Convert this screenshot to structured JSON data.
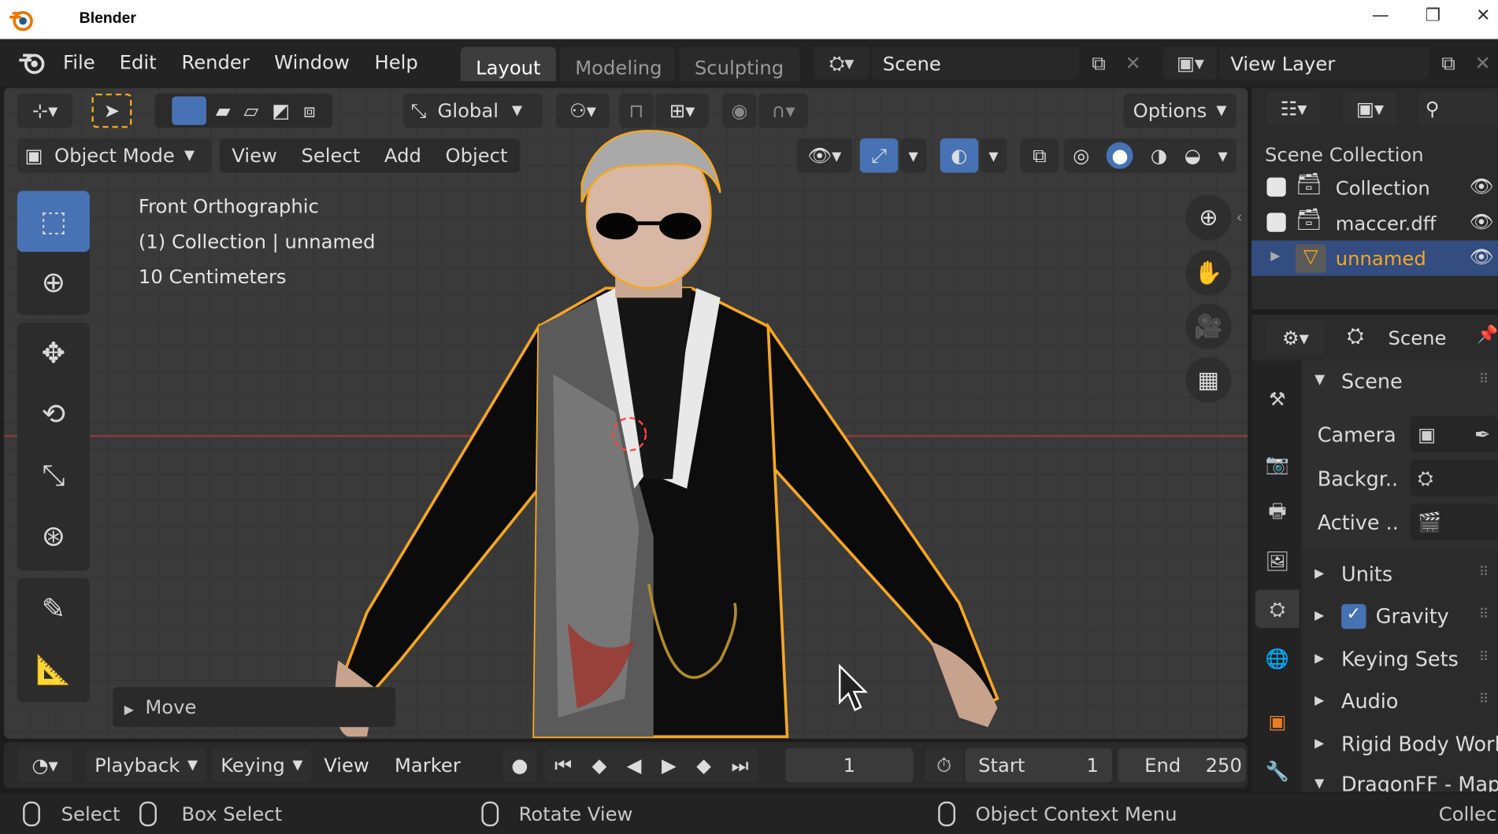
{
  "window": {
    "title": "Blender",
    "min": "—",
    "restore": "❐",
    "close": "✕"
  },
  "menu": {
    "file": "File",
    "edit": "Edit",
    "render": "Render",
    "window": "Window",
    "help": "Help"
  },
  "workspaces": [
    "Layout",
    "Modeling",
    "Sculpting"
  ],
  "scene_field": "Scene",
  "view_layer_field": "View Layer",
  "tool_header": {
    "transform_orientation": "Global",
    "options": "Options"
  },
  "viewport_header": {
    "mode": "Object Mode",
    "view": "View",
    "select": "Select",
    "add": "Add",
    "object": "Object"
  },
  "viewport_info": {
    "line1": "Front Orthographic",
    "line2": "(1) Collection | unnamed",
    "line3": "10 Centimeters"
  },
  "operator_panel": {
    "label": "Move"
  },
  "outliner": {
    "root": "Scene Collection",
    "items": [
      {
        "label": "Collection",
        "checked": true,
        "selected": false
      },
      {
        "label": "maccer.dff",
        "checked": true,
        "selected": false
      },
      {
        "label": "unnamed",
        "checked": null,
        "selected": true
      }
    ]
  },
  "properties": {
    "header": "Scene",
    "section": "Scene",
    "fields": [
      {
        "label": "Camera"
      },
      {
        "label": "Backgr.."
      },
      {
        "label": "Active .."
      }
    ],
    "subpanels": [
      "Units",
      "Gravity",
      "Keying Sets",
      "Audio",
      "Rigid Body World",
      "DragonFF - Map"
    ]
  },
  "timeline": {
    "playback": "Playback",
    "keying": "Keying",
    "view": "View",
    "marker": "Marker",
    "current_frame": "1",
    "start_label": "Start",
    "start_value": "1",
    "end_label": "End",
    "end_value": "250"
  },
  "status": {
    "select": "Select",
    "box_select": "Box Select",
    "rotate_view": "Rotate View",
    "context_menu": "Object Context Menu",
    "right_text": "Collec"
  },
  "colors": {
    "accent_blue": "#4772b3",
    "selection_orange": "#f5a623",
    "header_bg": "#232323",
    "viewport_bg": "#3a3a3a"
  }
}
